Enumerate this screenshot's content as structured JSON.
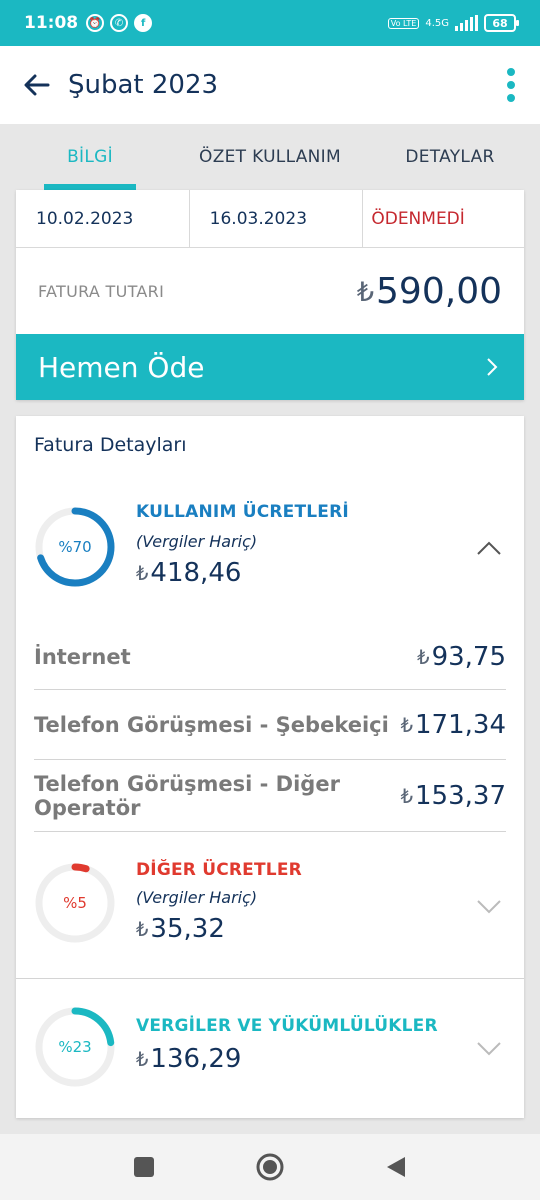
{
  "status_bar": {
    "time": "11:08",
    "network": "4.5G",
    "volte": "Vo LTE",
    "battery": "68"
  },
  "app_bar": {
    "title": "Şubat 2023"
  },
  "tabs": [
    {
      "label": "BİLGİ",
      "active": true
    },
    {
      "label": "ÖZET KULLANIM",
      "active": false
    },
    {
      "label": "DETAYLAR",
      "active": false
    }
  ],
  "summary": {
    "issue_date": "10.02.2023",
    "due_date": "16.03.2023",
    "status": "ÖDENMEDİ",
    "amount_label": "FATURA TUTARI",
    "currency": "₺",
    "amount": "590,00",
    "pay_label": "Hemen Öde"
  },
  "details": {
    "title": "Fatura Detayları",
    "groups": [
      {
        "title": "KULLANIM ÜCRETLERİ",
        "subtitle": "(Vergiler Hariç)",
        "amount": "418,46",
        "percent_label": "%70",
        "percent": 70,
        "color": "#1a7fc1",
        "expanded": true,
        "items": [
          {
            "label": "İnternet",
            "amount": "93,75"
          },
          {
            "label": "Telefon Görüşmesi - Şebekeiçi",
            "amount": "171,34"
          },
          {
            "label_line1": "Telefon Görüşmesi - Diğer",
            "label_line2": "Operatör",
            "amount": "153,37"
          }
        ]
      },
      {
        "title": "DİĞER ÜCRETLER",
        "subtitle": "(Vergiler Hariç)",
        "amount": "35,32",
        "percent_label": "%5",
        "percent": 5,
        "color": "#e03a2f",
        "expanded": false
      },
      {
        "title": "VERGİLER VE YÜKÜMLÜLÜKLER",
        "amount": "136,29",
        "percent_label": "%23",
        "percent": 23,
        "color": "#1bb8c2",
        "expanded": false
      }
    ]
  },
  "colors": {
    "accent": "#1bb8c2",
    "navy": "#14325a",
    "unpaid": "#c5282f"
  }
}
